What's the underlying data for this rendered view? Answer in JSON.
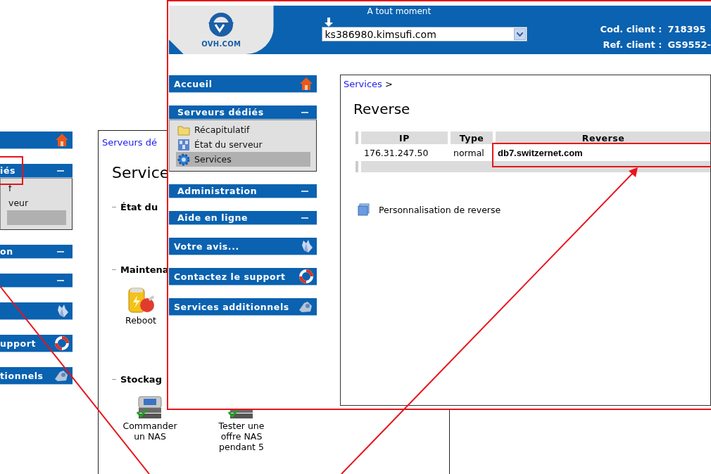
{
  "back_screen": {
    "sidebar": [
      {
        "kind": "link"
      },
      {
        "kind": "group",
        "label": "iés",
        "expanded": true,
        "children": [
          {
            "label": "f",
            "selected": false
          },
          {
            "label": "veur",
            "selected": false
          },
          {
            "selected": true
          }
        ]
      },
      {
        "kind": "group",
        "label": "on",
        "expanded": true
      },
      {
        "kind": "group",
        "expanded": true
      },
      {
        "kind": "link"
      },
      {
        "kind": "link",
        "label": "upport"
      },
      {
        "kind": "link",
        "label": "tionnels"
      }
    ],
    "breadcrumb": "Serveurs dé",
    "title": "Service",
    "sections": [
      {
        "title": "État du"
      },
      {
        "title": "Maintena",
        "items": [
          {
            "kind": "reboot",
            "label": "Reboot"
          }
        ]
      },
      {
        "title": "Stockag",
        "items": [
          {
            "kind": "nas",
            "label": "Commander un NAS"
          },
          {
            "kind": "nas",
            "label": "Tester une offre NAS pendant 5"
          }
        ]
      }
    ]
  },
  "front_screen": {
    "logo_text": "OVH.COM",
    "server_label": "A tout moment",
    "server_select": "ks386980.kimsufi.com",
    "client_info": [
      {
        "label": "Cod. client :",
        "value": "718395"
      },
      {
        "label": "Ref. client :",
        "value": "GS9552-"
      }
    ],
    "sidebar": [
      {
        "kind": "link",
        "label": "Accueil"
      },
      {
        "kind": "group",
        "label": "Serveurs dédiés",
        "expanded": true,
        "children": [
          {
            "label": "Récapitulatif",
            "selected": false
          },
          {
            "label": "État du serveur",
            "selected": false
          },
          {
            "label": "Services",
            "selected": true
          }
        ]
      },
      {
        "kind": "group",
        "label": "Administration",
        "expanded": true
      },
      {
        "kind": "group",
        "label": "Aide en ligne",
        "expanded": true
      },
      {
        "kind": "link",
        "label": "Votre avis..."
      },
      {
        "kind": "link",
        "label": "Contactez le support"
      },
      {
        "kind": "link",
        "label": "Services additionnels"
      }
    ],
    "breadcrumb": {
      "link": "Services",
      "separator": ">"
    },
    "title": "Reverse",
    "table": {
      "columns": [
        "IP",
        "Type",
        "Reverse"
      ],
      "rows": [
        [
          "176.31.247.50",
          "normal",
          "db7.switzernet.com"
        ]
      ]
    },
    "action_link": "Personnalisation de reverse"
  }
}
